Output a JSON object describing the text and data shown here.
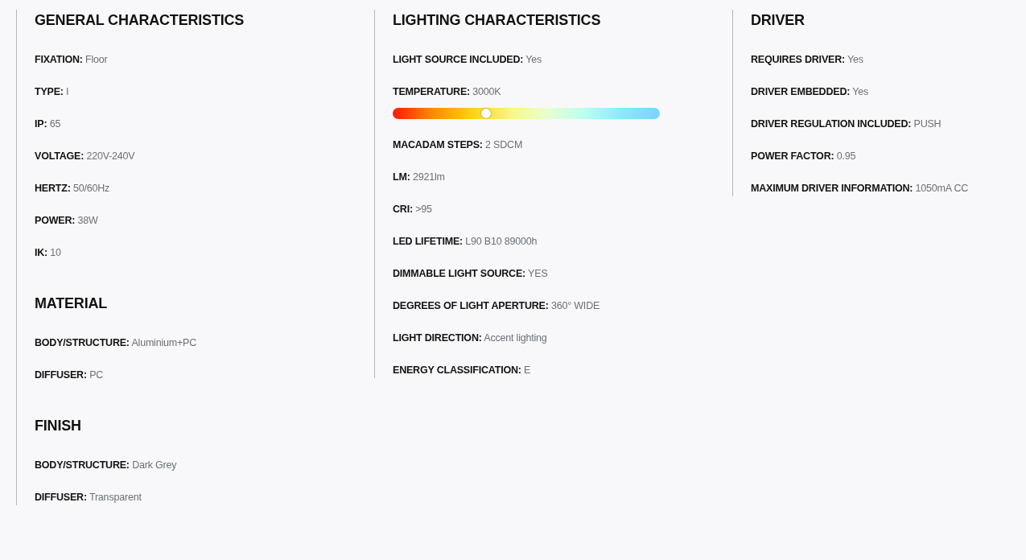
{
  "columns": [
    {
      "sections": [
        {
          "title": "GENERAL CHARACTERISTICS",
          "items": [
            {
              "kind": "spec",
              "label": "FIXATION:",
              "value": "Floor"
            },
            {
              "kind": "spec",
              "label": "TYPE:",
              "value": "I"
            },
            {
              "kind": "spec",
              "label": "IP:",
              "value": "65"
            },
            {
              "kind": "spec",
              "label": "VOLTAGE:",
              "value": "220V-240V"
            },
            {
              "kind": "spec",
              "label": "HERTZ:",
              "value": "50/60Hz"
            },
            {
              "kind": "spec",
              "label": "POWER:",
              "value": "38W"
            },
            {
              "kind": "spec",
              "label": "IK:",
              "value": "10"
            }
          ]
        },
        {
          "title": "MATERIAL",
          "items": [
            {
              "kind": "spec",
              "label": "BODY/STRUCTURE:",
              "value": "Aluminium+PC"
            },
            {
              "kind": "spec",
              "label": "DIFFUSER:",
              "value": "PC"
            }
          ]
        },
        {
          "title": "FINISH",
          "items": [
            {
              "kind": "spec",
              "label": "BODY/STRUCTURE:",
              "value": "Dark Grey"
            },
            {
              "kind": "spec",
              "label": "DIFFUSER:",
              "value": "Transparent"
            }
          ]
        }
      ]
    },
    {
      "sections": [
        {
          "title": "LIGHTING CHARACTERISTICS",
          "items": [
            {
              "kind": "spec",
              "label": "LIGHT SOURCE INCLUDED:",
              "value": "Yes"
            },
            {
              "kind": "scale",
              "label": "TEMPERATURE:",
              "value": "3000K",
              "level": 0.35
            },
            {
              "kind": "spec",
              "label": "MACADAM STEPS:",
              "value": "2 SDCM"
            },
            {
              "kind": "spec",
              "label": "LM:",
              "value": "2921lm"
            },
            {
              "kind": "spec",
              "label": "CRI:",
              "value": ">95"
            },
            {
              "kind": "spec",
              "label": "LED LIFETIME:",
              "value": "L90 B10 89000h"
            },
            {
              "kind": "spec",
              "label": "DIMMABLE LIGHT SOURCE:",
              "value": "YES"
            },
            {
              "kind": "spec",
              "label": "DEGREES OF LIGHT APERTURE:",
              "value": "360° WIDE"
            },
            {
              "kind": "spec",
              "label": "LIGHT DIRECTION:",
              "value": "Accent lighting"
            },
            {
              "kind": "spec",
              "label": "ENERGY CLASSIFICATION:",
              "value": "E"
            }
          ]
        }
      ]
    },
    {
      "sections": [
        {
          "title": "DRIVER",
          "items": [
            {
              "kind": "spec",
              "label": "REQUIRES DRIVER:",
              "value": "Yes"
            },
            {
              "kind": "spec",
              "label": "DRIVER EMBEDDED:",
              "value": "Yes"
            },
            {
              "kind": "spec",
              "label": "DRIVER REGULATION INCLUDED:",
              "value": "PUSH"
            },
            {
              "kind": "spec",
              "label": "POWER FACTOR:",
              "value": "0.95"
            },
            {
              "kind": "spec",
              "label": "MAXIMUM DRIVER INFORMATION:",
              "value": "1050mA CC"
            }
          ]
        }
      ]
    }
  ]
}
